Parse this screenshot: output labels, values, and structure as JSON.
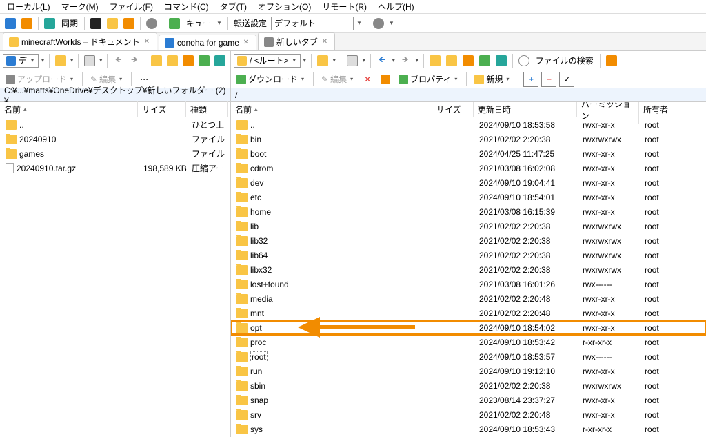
{
  "menu": [
    "ローカル(L)",
    "マーク(M)",
    "ファイル(F)",
    "コマンド(C)",
    "タブ(T)",
    "オプション(O)",
    "リモート(R)",
    "ヘルプ(H)"
  ],
  "toolbar1": {
    "sync_label": "同期",
    "queue_label": "キュー",
    "transfer_label": "転送設定",
    "transfer_preset": "デフォルト"
  },
  "tabs": [
    {
      "label": "minecraftWorlds – ドキュメント",
      "icon": "folder"
    },
    {
      "label": "conoha for game",
      "icon": "monitor",
      "active": true
    },
    {
      "label": "新しいタブ",
      "icon": "new"
    }
  ],
  "toolbar2": {
    "left_addr_short": "デ",
    "right_root": "/ <ルート>",
    "find_label": "ファイルの検索"
  },
  "toolbar3": {
    "upload": "アップロード",
    "edit": "編集",
    "download": "ダウンロード",
    "edit2": "編集",
    "properties": "プロパティ",
    "new": "新規"
  },
  "paths": {
    "left": "C:¥...¥matts¥OneDrive¥デスクトップ¥新しいフォルダー (2)¥",
    "right": "/"
  },
  "columns": {
    "left": [
      "名前",
      "サイズ",
      "種類"
    ],
    "right": [
      "名前",
      "サイズ",
      "更新日時",
      "パーミッション",
      "所有者"
    ]
  },
  "left_files": [
    {
      "name": "..",
      "icon": "up",
      "type": "ひとつ上"
    },
    {
      "name": "20240910",
      "icon": "folder",
      "type": "ファイル"
    },
    {
      "name": "games",
      "icon": "folder",
      "type": "ファイル"
    },
    {
      "name": "20240910.tar.gz",
      "icon": "file",
      "size": "198,589 KB",
      "type": "圧縮アー"
    }
  ],
  "right_files": [
    {
      "name": "..",
      "icon": "up",
      "date": "2024/09/10 18:53:58",
      "perm": "rwxr-xr-x",
      "owner": "root"
    },
    {
      "name": "bin",
      "icon": "folder",
      "link": true,
      "date": "2021/02/02 2:20:38",
      "perm": "rwxrwxrwx",
      "owner": "root"
    },
    {
      "name": "boot",
      "icon": "folder",
      "date": "2024/04/25 11:47:25",
      "perm": "rwxr-xr-x",
      "owner": "root"
    },
    {
      "name": "cdrom",
      "icon": "folder",
      "date": "2021/03/08 16:02:08",
      "perm": "rwxr-xr-x",
      "owner": "root"
    },
    {
      "name": "dev",
      "icon": "folder",
      "date": "2024/09/10 19:04:41",
      "perm": "rwxr-xr-x",
      "owner": "root"
    },
    {
      "name": "etc",
      "icon": "folder",
      "date": "2024/09/10 18:54:01",
      "perm": "rwxr-xr-x",
      "owner": "root"
    },
    {
      "name": "home",
      "icon": "folder",
      "date": "2021/03/08 16:15:39",
      "perm": "rwxr-xr-x",
      "owner": "root"
    },
    {
      "name": "lib",
      "icon": "folder",
      "link": true,
      "date": "2021/02/02 2:20:38",
      "perm": "rwxrwxrwx",
      "owner": "root"
    },
    {
      "name": "lib32",
      "icon": "folder",
      "link": true,
      "date": "2021/02/02 2:20:38",
      "perm": "rwxrwxrwx",
      "owner": "root"
    },
    {
      "name": "lib64",
      "icon": "folder",
      "link": true,
      "date": "2021/02/02 2:20:38",
      "perm": "rwxrwxrwx",
      "owner": "root"
    },
    {
      "name": "libx32",
      "icon": "folder",
      "link": true,
      "date": "2021/02/02 2:20:38",
      "perm": "rwxrwxrwx",
      "owner": "root"
    },
    {
      "name": "lost+found",
      "icon": "folder",
      "date": "2021/03/08 16:01:26",
      "perm": "rwx------",
      "owner": "root"
    },
    {
      "name": "media",
      "icon": "folder",
      "date": "2021/02/02 2:20:48",
      "perm": "rwxr-xr-x",
      "owner": "root"
    },
    {
      "name": "mnt",
      "icon": "folder",
      "date": "2021/02/02 2:20:48",
      "perm": "rwxr-xr-x",
      "owner": "root"
    },
    {
      "name": "opt",
      "icon": "folder",
      "date": "2024/09/10 18:54:02",
      "perm": "rwxr-xr-x",
      "owner": "root",
      "highlight": true
    },
    {
      "name": "proc",
      "icon": "folder",
      "date": "2024/09/10 18:53:42",
      "perm": "r-xr-xr-x",
      "owner": "root"
    },
    {
      "name": "root",
      "icon": "folder",
      "date": "2024/09/10 18:53:57",
      "perm": "rwx------",
      "owner": "root",
      "selected": true
    },
    {
      "name": "run",
      "icon": "folder",
      "date": "2024/09/10 19:12:10",
      "perm": "rwxr-xr-x",
      "owner": "root"
    },
    {
      "name": "sbin",
      "icon": "folder",
      "link": true,
      "date": "2021/02/02 2:20:38",
      "perm": "rwxrwxrwx",
      "owner": "root"
    },
    {
      "name": "snap",
      "icon": "folder",
      "date": "2023/08/14 23:37:27",
      "perm": "rwxr-xr-x",
      "owner": "root"
    },
    {
      "name": "srv",
      "icon": "folder",
      "date": "2021/02/02 2:20:48",
      "perm": "rwxr-xr-x",
      "owner": "root"
    },
    {
      "name": "sys",
      "icon": "folder",
      "date": "2024/09/10 18:53:43",
      "perm": "r-xr-xr-x",
      "owner": "root"
    }
  ]
}
